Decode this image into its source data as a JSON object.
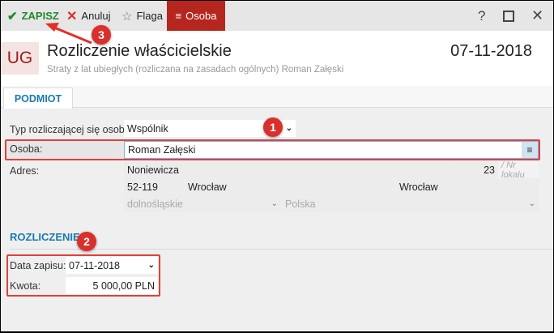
{
  "toolbar": {
    "save": "ZAPISZ",
    "cancel": "Anuluj",
    "flag": "Flaga",
    "person": "Osoba",
    "help": "?"
  },
  "header": {
    "badge": "UG",
    "title": "Rozliczenie właścicielskie",
    "subtitle": "Straty z lat ubiegłych (rozliczana na zasadach ogólnych) Roman Załęski",
    "date": "07-11-2018"
  },
  "tabs": [
    {
      "label": "PODMIOT"
    }
  ],
  "form": {
    "type_label": "Typ rozliczającej się osoby:",
    "type_value": "Wspólnik",
    "person_label": "Osoba:",
    "person_value": "Roman Załęski",
    "address_label": "Adres:",
    "street": "Noniewicza",
    "house_no": "23",
    "apt_placeholder": "/ Nr lokalu",
    "postal": "52-119",
    "city": "Wrocław",
    "post_city": "Wrocław",
    "voivodeship": "dolnośląskie",
    "country": "Polska"
  },
  "settlement": {
    "section": "ROZLICZENIE",
    "date_label": "Data zapisu:",
    "date_value": "07-11-2018",
    "amount_label": "Kwota:",
    "amount_value": "5 000,00 PLN"
  },
  "annotations": [
    "1",
    "2",
    "3"
  ],
  "colors": {
    "accent": "#b5261e",
    "section": "#1a7bb0",
    "annotation": "#d9302b"
  }
}
